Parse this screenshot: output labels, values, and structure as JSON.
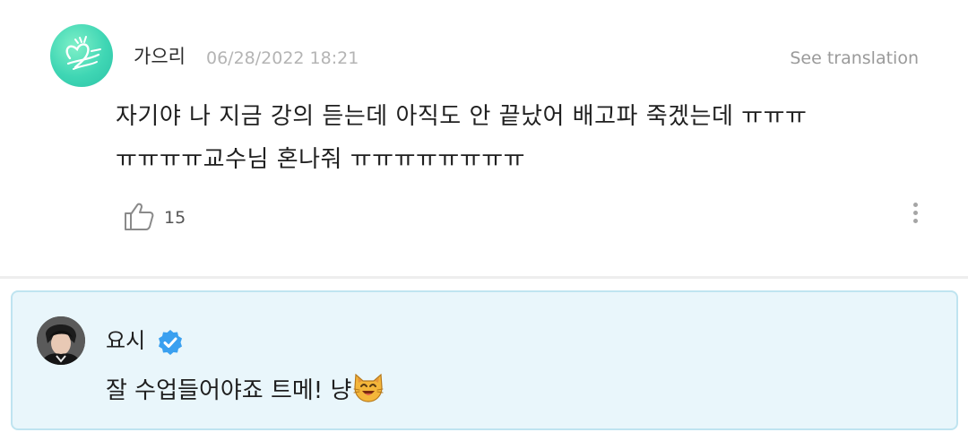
{
  "post": {
    "author": "가으리",
    "timestamp": "06/28/2022 18:21",
    "see_translation": "See translation",
    "body": "자기야 나 지금 강의 듣는데 아직도 안 끝났어 배고파 죽겠는데 ㅠㅠㅠ\nㅠㅠㅠㅠ교수님 혼나줘 ㅠㅠㅠㅠㅠㅠㅠㅠ",
    "like_count": "15",
    "icons": {
      "avatar": "heart-doodle-avatar",
      "like": "thumbs-up-icon",
      "more": "more-vertical-icon"
    }
  },
  "reply": {
    "author": "요시",
    "verified": true,
    "text": "잘 수업들어야죠 트메! 냥",
    "emoji": "smiling-cat-emoji"
  },
  "colors": {
    "reply_background": "#e9f6fb",
    "reply_border": "#bfe4f0",
    "verified_blue": "#3aa0f0",
    "avatar_mint": "#3fd6b4"
  }
}
